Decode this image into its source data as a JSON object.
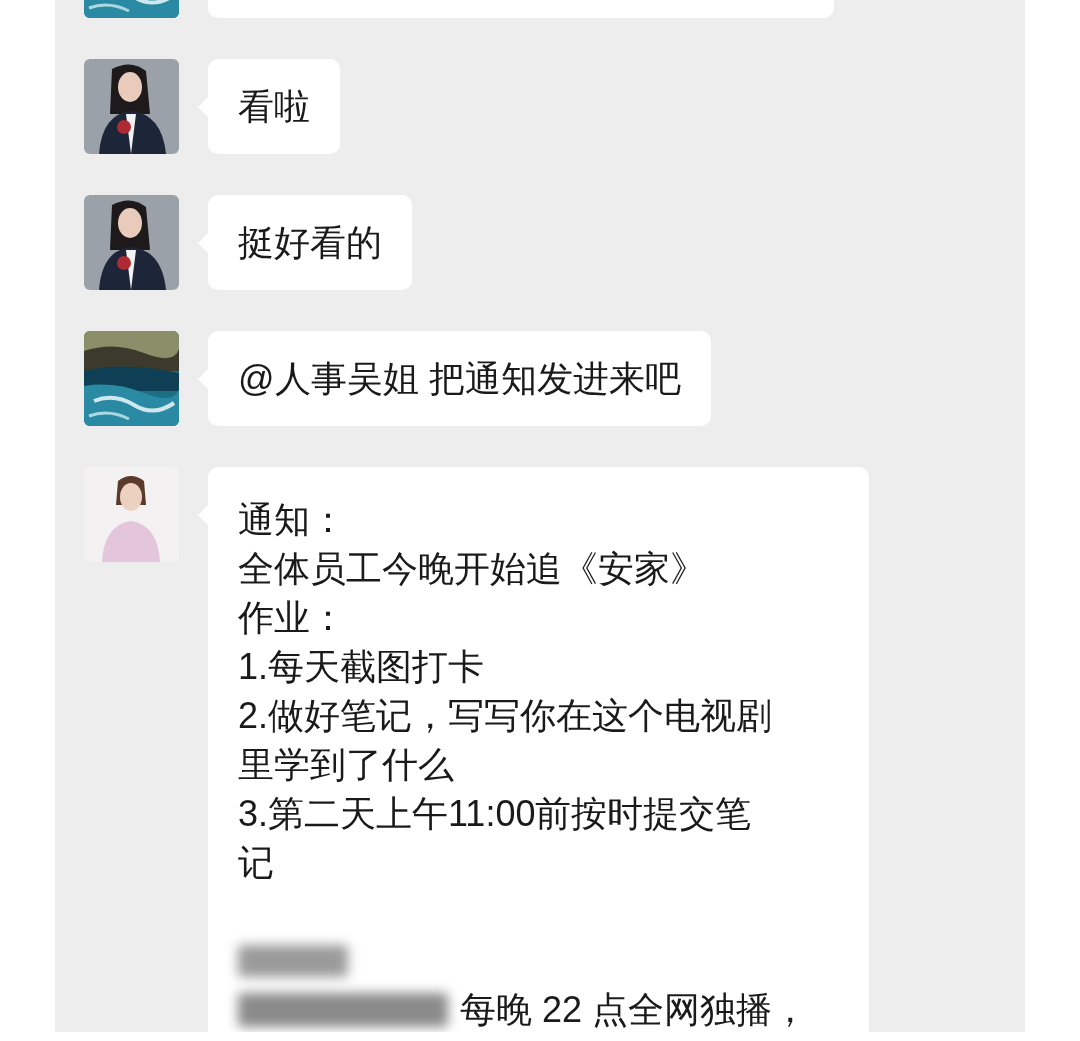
{
  "messages": [
    {
      "avatar": {
        "kind": "picture"
      }
    },
    {
      "avatar": {
        "kind": "picture"
      },
      "lines": [
        {
          "kind": "text",
          "text": "看啦"
        }
      ]
    },
    {
      "avatar": {
        "kind": "picture"
      },
      "lines": [
        {
          "kind": "text",
          "text": "挺好看的"
        }
      ]
    },
    {
      "avatar": {
        "kind": "picture"
      },
      "lines": [
        {
          "kind": "text",
          "text": "@人事吴姐 把通知发进来吧"
        }
      ]
    },
    {
      "avatar": {
        "kind": "picture"
      },
      "lines": [
        {
          "kind": "text",
          "text": "通知："
        },
        {
          "kind": "text",
          "text": "全体员工今晚开始追《安家》"
        },
        {
          "kind": "text",
          "text": "作业："
        },
        {
          "kind": "text",
          "text": "1.每天截图打卡"
        },
        {
          "kind": "text",
          "text": "2.做好笔记，写写你在这个电视剧"
        },
        {
          "kind": "text",
          "text": "里学到了什么"
        },
        {
          "kind": "text",
          "text": "3.第二天上午11:00前按时提交笔"
        },
        {
          "kind": "text",
          "text": "记"
        },
        {
          "kind": "blank"
        },
        {
          "kind": "redacted"
        },
        {
          "kind": "redacted_text",
          "text": "每晚 22 点全网独播，"
        }
      ]
    }
  ]
}
